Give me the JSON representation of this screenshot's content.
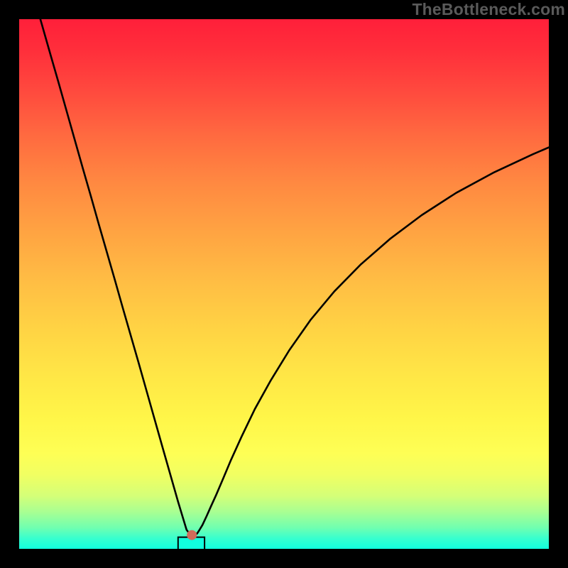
{
  "watermark": "TheBottleneck.com",
  "chart_data": {
    "type": "line",
    "title": "",
    "xlabel": "",
    "ylabel": "",
    "xlim": [
      0,
      1
    ],
    "ylim": [
      0,
      1
    ],
    "curve": {
      "note": "V-shaped bottleneck curve; x,y in [0,1] plot-area units (y=0 is top)",
      "x": [
        0.04,
        0.06,
        0.075,
        0.09,
        0.105,
        0.12,
        0.135,
        0.15,
        0.165,
        0.18,
        0.195,
        0.21,
        0.225,
        0.24,
        0.255,
        0.27,
        0.28,
        0.29,
        0.3,
        0.316,
        0.322,
        0.326,
        0.328,
        0.332,
        0.336,
        0.34,
        0.346,
        0.354,
        0.362,
        0.372,
        0.384,
        0.4,
        0.42,
        0.445,
        0.475,
        0.51,
        0.55,
        0.595,
        0.645,
        0.7,
        0.76,
        0.825,
        0.895,
        0.97,
        1.0
      ],
      "y": [
        0.0,
        0.07,
        0.122,
        0.175,
        0.228,
        0.281,
        0.333,
        0.386,
        0.438,
        0.49,
        0.543,
        0.595,
        0.647,
        0.7,
        0.753,
        0.806,
        0.841,
        0.876,
        0.911,
        0.964,
        0.972,
        0.974,
        0.975,
        0.974,
        0.971,
        0.965,
        0.955,
        0.938,
        0.92,
        0.898,
        0.87,
        0.832,
        0.788,
        0.736,
        0.682,
        0.625,
        0.568,
        0.514,
        0.463,
        0.415,
        0.37,
        0.328,
        0.29,
        0.255,
        0.242
      ]
    },
    "dot": {
      "x": 0.326,
      "y": 0.974,
      "color": "#d06a5a",
      "radius_px": 7
    },
    "dip_rect": {
      "x0": 0.3,
      "x1": 0.35,
      "y": 0.978
    },
    "colors": {
      "curve": "#000000",
      "background_gradient": [
        "#ff1f3a",
        "#11ffde"
      ]
    }
  }
}
